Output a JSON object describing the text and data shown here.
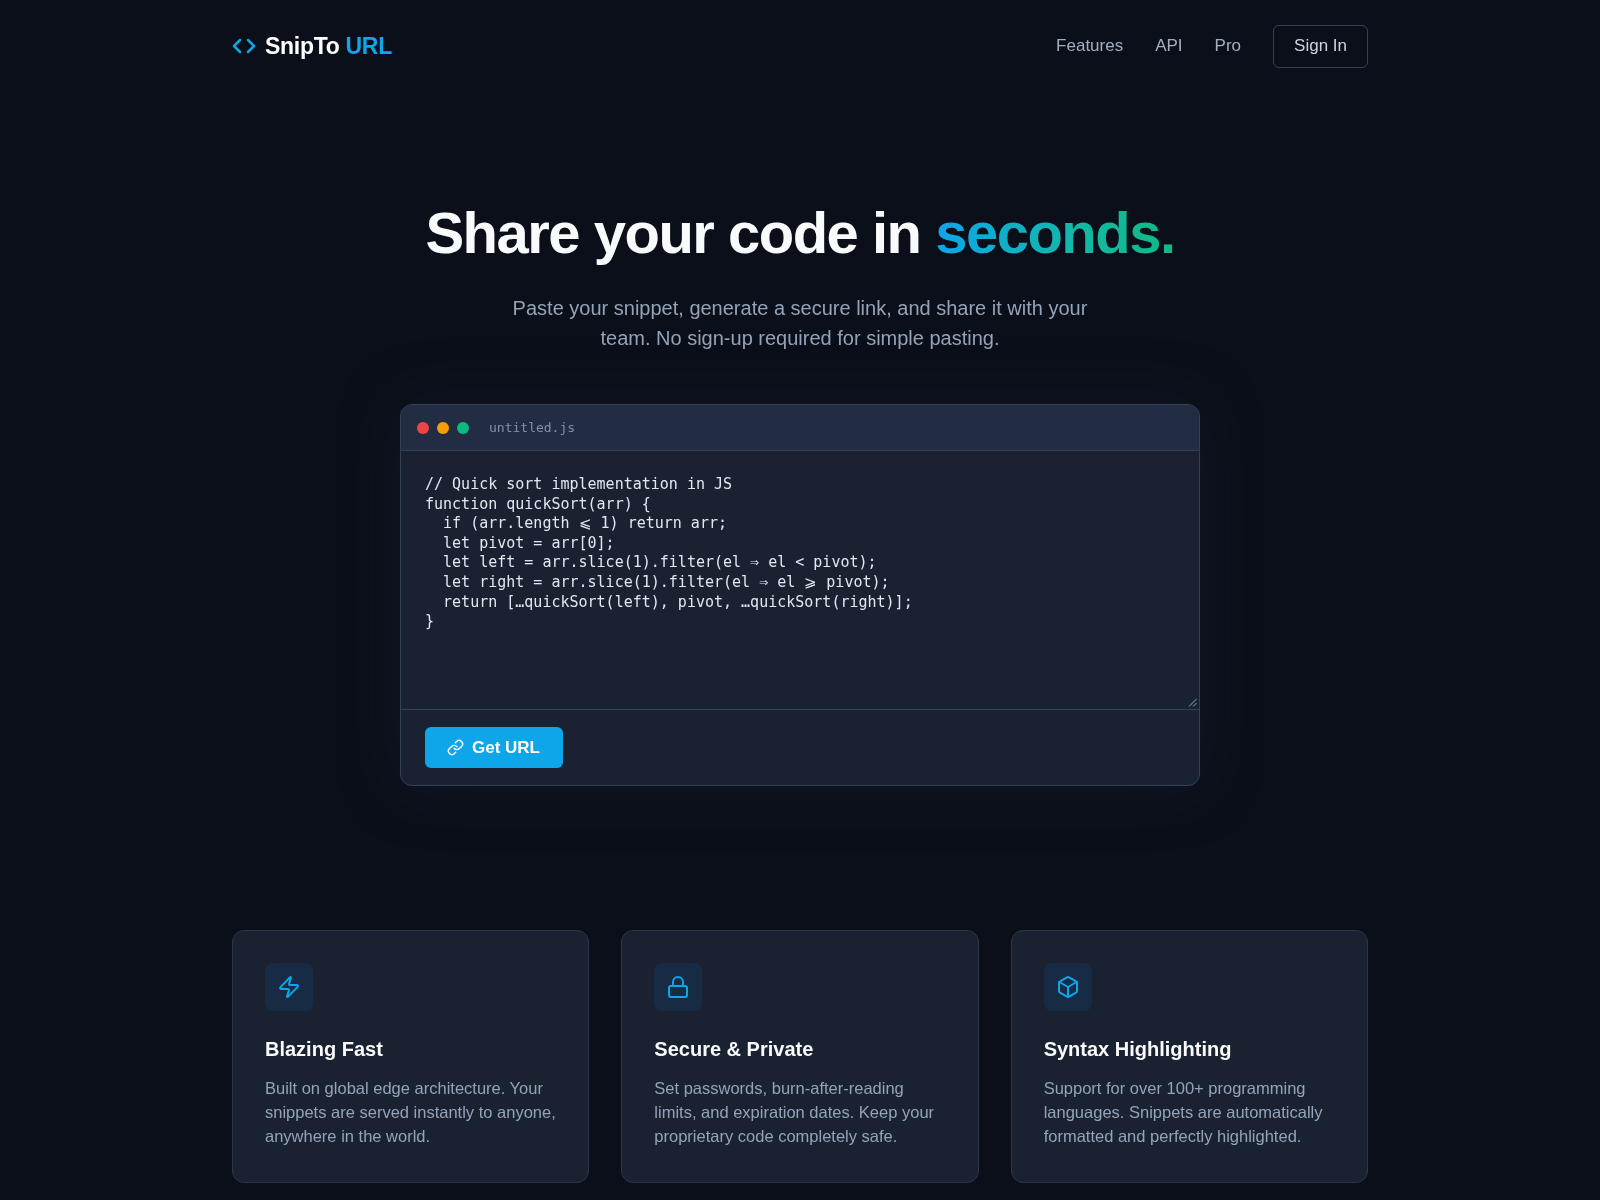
{
  "header": {
    "brand": {
      "name": "SnipTo",
      "accent": "URL"
    },
    "nav_links": [
      "Features",
      "API",
      "Pro"
    ],
    "sign_in_button": "Sign In"
  },
  "hero": {
    "title": "Share your code in",
    "title_highlight": "seconds.",
    "subtitle": "Paste your snippet, generate a secure link, and share it with your team. No sign-up required for simple pasting."
  },
  "editor": {
    "window_dots": [
      {
        "color": "#ef4444"
      },
      {
        "color": "#f59e0b"
      },
      {
        "color": "#10b981"
      }
    ],
    "filename": "untitled.js",
    "code_lines": [
      "// Quick sort implementation in JS",
      "function quickSort(arr) {",
      "  if (arr.length ⩽ 1) return arr;",
      "  let pivot = arr[0];",
      "  let left = arr.slice(1).filter(el ⇒ el < pivot);",
      "  let right = arr.slice(1).filter(el ⇒ el ⩾ pivot);",
      "  return […quickSort(left), pivot, …quickSort(right)];",
      "}"
    ],
    "submit_button": "Get URL"
  },
  "features": [
    {
      "title": "Blazing Fast",
      "description": "Built on global edge architecture. Your snippets are served instantly to anyone, anywhere in the world."
    },
    {
      "title": "Secure & Private",
      "description": "Set passwords, burn-after-reading limits, and expiration dates. Keep your proprietary code completely safe."
    },
    {
      "title": "Syntax Highlighting",
      "description": "Support for over 100+ programming languages. Snippets are automatically formatted and perfectly highlighted."
    }
  ]
}
